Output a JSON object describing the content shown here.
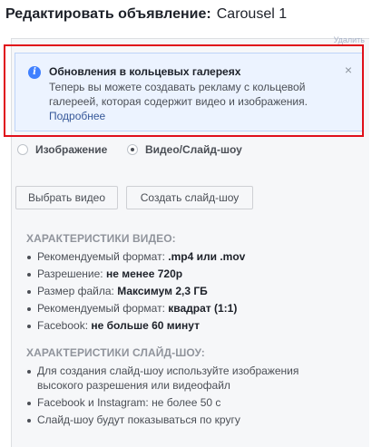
{
  "header": {
    "title": "Редактировать объявление:",
    "ad_name": "Carousel 1",
    "top_link": "Удалить"
  },
  "notice": {
    "title": "Обновления в кольцевых галереях",
    "body": "Теперь вы можете создавать рекламу с кольцевой галереей, которая содержит видео и изображения.",
    "link": "Подробнее",
    "icon": "info-icon",
    "close_glyph": "×",
    "highlight_color": "#e0101a"
  },
  "media_type": {
    "options": [
      {
        "label": "Изображение",
        "selected": false
      },
      {
        "label": "Видео/Слайд-шоу",
        "selected": true
      }
    ]
  },
  "buttons": {
    "choose_video": "Выбрать видео",
    "create_slideshow": "Создать слайд-шоу"
  },
  "video_specs": {
    "heading": "ХАРАКТЕРИСТИКИ ВИДЕО:",
    "items": [
      {
        "label": "Рекомендуемый формат:",
        "value": ".mp4 или .mov"
      },
      {
        "label": "Разрешение:",
        "value": "не менее 720p"
      },
      {
        "label": "Размер файла:",
        "value": "Максимум 2,3 ГБ"
      },
      {
        "label": "Рекомендуемый формат:",
        "value": "квадрат (1:1)"
      },
      {
        "label": "Facebook:",
        "value": "не больше 60 минут"
      }
    ]
  },
  "slideshow_specs": {
    "heading": "ХАРАКТЕРИСТИКИ СЛАЙД-ШОУ:",
    "items": [
      {
        "label": "Для создания слайд-шоу используйте изображения высокого разрешения или видеофайл"
      },
      {
        "label": "Facebook и Instagram: не более 50 с"
      },
      {
        "label": "Слайд-шоу будут показываться по кругу"
      }
    ]
  }
}
